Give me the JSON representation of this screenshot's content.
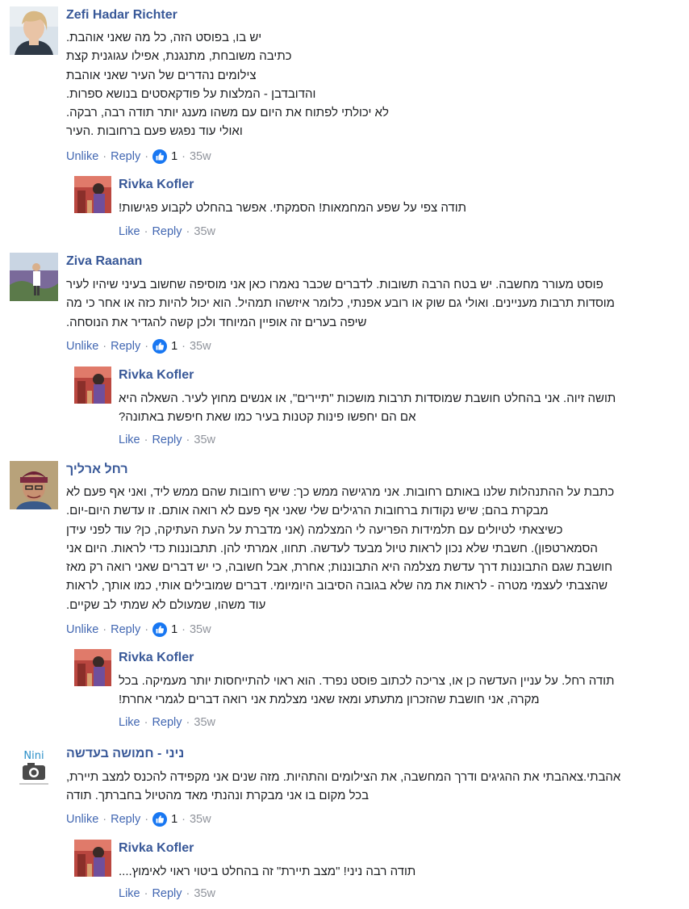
{
  "comments": [
    {
      "author": "Zefi Hadar Richter",
      "lines": [
        "יש בו, בפוסט הזה, כל מה שאני אוהבת.",
        "כתיבה משובחת, מתנגנת, אפילו עגוגנית קצת",
        "צילומים נהדרים של העיר שאני אוהבת",
        "והדובדבן - המלצות על פודקאסטים בנושא ספרות.",
        "לא יכולתי לפתוח את היום עם משהו מענג יותר תודה רבה, רבקה.",
        "ואולי עוד נפגש פעם ברחובות .העיר"
      ],
      "unlike": "Unlike",
      "reply": "Reply",
      "likes": "1",
      "time": "35w",
      "response": {
        "author": "Rivka Kofler",
        "lines": [
          "תודה צפי על שפע המחמאות! הסמקתי. אפשר בהחלט לקבוע פגישות!"
        ],
        "like": "Like",
        "reply": "Reply",
        "time": "35w"
      }
    },
    {
      "author": "Ziva Raanan",
      "lines": [
        "פוסט מעורר מחשבה. יש בטח הרבה תשובות. לדברים שכבר נאמרו כאן אני מוסיפה שחשוב בעיני שיהיו לעיר",
        "מוסדות תרבות מעניינים. ואולי גם שוק או רובע אפנתי, כלומר איזשהו תמהיל. הוא יכול להיות כזה או אחר כי מה",
        "שיפה בערים זה אופיין המיוחד ולכן קשה להגדיר את הנוסחה."
      ],
      "unlike": "Unlike",
      "reply": "Reply",
      "likes": "1",
      "time": "35w",
      "response": {
        "author": "Rivka Kofler",
        "lines": [
          "תושה זיוה. אני בהחלט חושבת שמוסדות תרבות מושכות \"תיירים\", או אנשים מחוץ לעיר. השאלה היא",
          "אם הם יחפשו פינות קטנות בעיר כמו שאת חיפשת באתונה?"
        ],
        "like": "Like",
        "reply": "Reply",
        "time": "35w"
      }
    },
    {
      "author": "רחל ארליך",
      "lines": [
        "כתבת על ההתנהלות שלנו באותם רחובות. אני מרגישה ממש כך: שיש רחובות שהם ממש ליד, ואני אף פעם לא",
        "מבקרת בהם; שיש נקודות ברחובות הרגילים שלי שאני אף פעם לא רואה אותם. זו עדשת היום-יום.",
        "כשיצאתי לטיולים עם תלמידות הפריעה לי המצלמה (אני מדברת על העת העתיקה, כן? עוד לפני עידן",
        "הסמארטפון). חשבתי שלא נכון לראות טיול מבעד לעדשה. תחוו, אמרתי להן. תתבוננות כדי לראות. היום אני",
        "חושבת שגם התבוננות דרך עדשת מצלמה היא התבוננות; אחרת, אבל חשובה, כי יש דברים שאני רואה רק מאז",
        "שהצבתי לעצמי מטרה - לראות את מה שלא בגובה הסיבוב היומיומי. דברים שמובילים אותי, כמו אותך, לראות",
        "עוד משהו, שמעולם לא שמתי לב שקיים."
      ],
      "unlike": "Unlike",
      "reply": "Reply",
      "likes": "1",
      "time": "35w",
      "response": {
        "author": "Rivka Kofler",
        "lines": [
          "תודה רחל. על עניין העדשה כן או, צריכה לכתוב פוסט נפרד. הוא ראוי להתייחסות יותר מעמיקה. בכל",
          "מקרה, אני חושבת שהזכרון מתעתע ומאז שאני מצלמת אני רואה דברים לגמרי אחרת!"
        ],
        "like": "Like",
        "reply": "Reply",
        "time": "35w"
      }
    },
    {
      "author": "ניני - חמושה בעדשה",
      "lines": [
        "אהבתי.צאהבתי את ההגיגים ודרך המחשבה, את הצילומים והתהיות. מזה שנים אני מקפידה להכנס למצב תיירת,",
        "בכל מקום בו אני מבקרת ונהנתי מאד מהטיול בחברתך. תודה"
      ],
      "unlike": "Unlike",
      "reply": "Reply",
      "likes": "1",
      "time": "35w",
      "avatar_text": "Nini",
      "response": {
        "author": "Rivka Kofler",
        "lines": [
          "תודה רבה ניני! \"מצב תיירת\" זה בהחלט ביטוי ראוי לאימוץ...."
        ],
        "like": "Like",
        "reply": "Reply",
        "time": "35w"
      }
    }
  ],
  "colors": {
    "link": "#385898",
    "action": "#4267b2",
    "meta": "#90949c",
    "text": "#1c1e21",
    "like_badge": "#1877f2"
  }
}
